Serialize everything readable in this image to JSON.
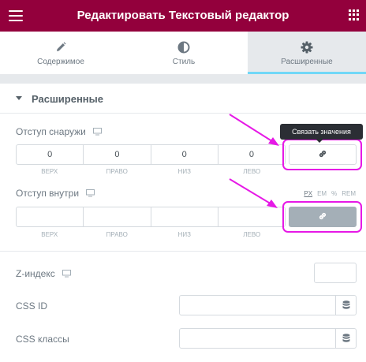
{
  "header": {
    "title": "Редактировать Текстовый редактор",
    "menu_icon": "hamburger-icon",
    "grid_icon": "apps-grid-icon"
  },
  "tabs": [
    {
      "label": "Содержимое",
      "icon": "pencil-icon"
    },
    {
      "label": "Стиль",
      "icon": "half-circle-icon"
    },
    {
      "label": "Расширенные",
      "icon": "gear-icon",
      "active": true
    }
  ],
  "section": {
    "title": "Расширенные"
  },
  "margin": {
    "label": "Отступ снаружи",
    "values": [
      "0",
      "0",
      "0",
      "0"
    ],
    "sides": [
      "ВЕРХ",
      "ПРАВО",
      "НИЗ",
      "ЛЕВО"
    ],
    "tooltip": "Связать значения"
  },
  "padding": {
    "label": "Отступ внутри",
    "values": [
      "",
      "",
      "",
      ""
    ],
    "sides": [
      "ВЕРХ",
      "ПРАВО",
      "НИЗ",
      "ЛЕВО"
    ],
    "units": [
      "PX",
      "EM",
      "%",
      "REM"
    ],
    "selected_unit": "PX"
  },
  "z_index": {
    "label": "Z-индекс",
    "value": ""
  },
  "css_id": {
    "label": "CSS ID",
    "value": ""
  },
  "css_classes": {
    "label": "CSS классы",
    "value": ""
  },
  "colors": {
    "brand": "#93003c",
    "highlight": "#e619e6",
    "tab_accent": "#71d7f7"
  }
}
